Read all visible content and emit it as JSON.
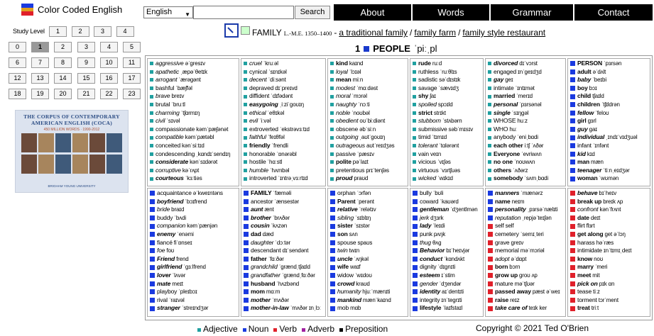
{
  "header": {
    "app_title": "Color Coded English",
    "language": "English",
    "search_placeholder": "",
    "search_button": "Search",
    "nav": [
      "About",
      "Words",
      "Grammar",
      "Contact"
    ]
  },
  "sidebar": {
    "level_label": "Study Level",
    "levels": [
      "1",
      "2",
      "3",
      "4",
      "0",
      "1",
      "2",
      "3",
      "4",
      "5",
      "6",
      "7",
      "8",
      "9",
      "10",
      "11",
      "12",
      "13",
      "14",
      "15",
      "16",
      "17",
      "18",
      "19",
      "20",
      "21",
      "22",
      "23"
    ]
  },
  "coca": {
    "title": "THE CORPUS OF CONTEMPORARY AMERICAN ENGLISH (COCA)",
    "sub": "450 MILLION WORDS · 1990-2012",
    "footer": "BRIGHAM YOUNG UNIVERSITY"
  },
  "entry": {
    "word": "FAMILY",
    "pos": "L.-M.E. 1350–1400",
    "dash": "-",
    "phrase1": "a traditional family",
    "slash1": "/",
    "phrase2": "family farm",
    "slash2": "/",
    "phrase3": "family style restaurant"
  },
  "section": {
    "number": "1",
    "title": "PEOPLE",
    "ipa": "ˈpiːˌpl"
  },
  "colors": {
    "adjective": "#20a0a0",
    "noun": "#1a3ae0",
    "verb": "#e0202a",
    "adverb": "#a020a0",
    "preposition": "#000000"
  },
  "columns": [
    [
      [
        [
          "a",
          "aggressive",
          "əˈgresɪv",
          1
        ],
        [
          "a",
          "apathetic",
          "ˌæpəˈθetɪk",
          1
        ],
        [
          "a",
          "arrogant",
          "ˈærəgənt",
          1
        ],
        [
          "a",
          "bashful",
          "ˈbæʃfəl",
          0
        ],
        [
          "a",
          "brave",
          "breɪv",
          1
        ],
        [
          "a",
          "brutal",
          "ˈbruːtl",
          0
        ],
        [
          "a",
          "charming",
          "ˈtʃɑrmɪŋ",
          1
        ],
        [
          "a",
          "civil",
          "ˈsɪvəl",
          1
        ],
        [
          "a",
          "compassionate",
          "kəmˈpæʃənət",
          0
        ],
        [
          "a",
          "compatible",
          "kəmˈpætəbl",
          1
        ],
        [
          "a",
          "conceited",
          "kənˈsiːtɪd",
          0
        ],
        [
          "a",
          "condescending",
          "ˌkɑndɪˈsendɪŋ",
          0
        ],
        [
          "a",
          "considerate",
          "kənˈsɪdərət",
          2
        ],
        [
          "a",
          "corruptive",
          "kəˈrʌpt",
          1
        ],
        [
          "a",
          "courteous",
          "ˈkɜːtiəs",
          2
        ]
      ],
      [
        [
          "n",
          "acquaintance",
          "əˈkweɪntəns",
          0
        ],
        [
          "n",
          "boyfriend",
          "ˈbɔɪfrend",
          2
        ],
        [
          "n",
          "bride",
          "braɪd",
          1
        ],
        [
          "n",
          "buddy",
          "ˈbʌdi",
          0
        ],
        [
          "n",
          "companion",
          "kəmˈpænjən",
          1
        ],
        [
          "n",
          "enemy",
          "ˈenəmi",
          2
        ],
        [
          "n",
          "fiancé",
          "fiˈɒnseɪ",
          0
        ],
        [
          "n",
          "foe",
          "foʊ",
          1
        ],
        [
          "n",
          "Friend",
          "frend",
          2
        ],
        [
          "n",
          "girlfriend",
          "ˈgɜːlfrend",
          2
        ],
        [
          "n",
          "lover",
          "ˈlʌvər",
          2
        ],
        [
          "n",
          "mate",
          "meɪt",
          2
        ],
        [
          "n",
          "playboy",
          "ˈpleɪbɔɪ",
          0
        ],
        [
          "n",
          "rival",
          "ˈraɪvəl",
          0
        ],
        [
          "n",
          "stranger",
          "ˈstreɪndʒər",
          2
        ]
      ]
    ],
    [
      [
        [
          "a",
          "cruel",
          "ˈkruːəl",
          1
        ],
        [
          "a",
          "cynical",
          "ˈsɪnɪkəl",
          0
        ],
        [
          "a",
          "decent",
          "ˈdiːsənt",
          1
        ],
        [
          "a",
          "depraved",
          "dɪˈpreɪvd",
          0
        ],
        [
          "a",
          "diffident",
          "ˈdɪfədənt",
          0
        ],
        [
          "a",
          "easygoing",
          "ˌiːziˈgoʊɪŋ",
          2
        ],
        [
          "a",
          "ethical",
          "ˈeθɪkəl",
          1
        ],
        [
          "a",
          "evil",
          "ˈiːvəl",
          1
        ],
        [
          "a",
          "extroverted",
          "ˈekstrəvɜːtɪd",
          0
        ],
        [
          "a",
          "faithful",
          "ˈfeɪθfəl",
          1
        ],
        [
          "a",
          "friendly",
          "ˈfrendli",
          3
        ],
        [
          "a",
          "honorable",
          "ˈɒnərəbl",
          0
        ],
        [
          "a",
          "hostile",
          "ˈhɑːstl",
          0
        ],
        [
          "a",
          "humble",
          "ˈhʌmbəl",
          1
        ],
        [
          "a",
          "introverted",
          "ˈɪntrəˌvɜːrtɪd",
          0
        ]
      ],
      [
        [
          "n",
          "FAMILY",
          "ˈfæməli",
          3
        ],
        [
          "n",
          "ancestor",
          "ˈænsestər",
          0
        ],
        [
          "n",
          "aunt",
          "ænt",
          2
        ],
        [
          "n",
          "brother",
          "ˈbrʌðər",
          2
        ],
        [
          "n",
          "cousin",
          "ˈkʌzən",
          2
        ],
        [
          "n",
          "dad",
          "dæd",
          3
        ],
        [
          "n",
          "daughter",
          "ˈdɔːtər",
          1
        ],
        [
          "n",
          "descendant",
          "dɪˈsendənt",
          0
        ],
        [
          "n",
          "father",
          "ˈfɑːðər",
          3
        ],
        [
          "n",
          "grandchild",
          "ˈgrændˌtʃaɪld",
          1
        ],
        [
          "n",
          "grandfather",
          "ˈgrændˌfɑːðər",
          1
        ],
        [
          "n",
          "husband",
          "ˈhʌzbənd",
          3
        ],
        [
          "n",
          "mom",
          "mɑːm",
          3
        ],
        [
          "n",
          "mother",
          "ˈmʌðər",
          2
        ],
        [
          "n",
          "mother-in-law",
          "ˈmʌðər ɪnˌlɔː",
          2
        ]
      ]
    ],
    [
      [
        [
          "a",
          "kind",
          "kaɪnd",
          3
        ],
        [
          "a",
          "loyal",
          "ˈlɔɪəl",
          1
        ],
        [
          "a",
          "mean",
          "miːn",
          3
        ],
        [
          "a",
          "modest",
          "ˈmɑːdəst",
          1
        ],
        [
          "a",
          "moral",
          "ˈmɔrəl",
          1
        ],
        [
          "a",
          "naughty",
          "ˈnɔːti",
          1
        ],
        [
          "a",
          "noble",
          "ˈnoʊbəl",
          1
        ],
        [
          "a",
          "obedient",
          "oʊˈbiːdiənt",
          1
        ],
        [
          "a",
          "obscene",
          "əbˈsiːn",
          0
        ],
        [
          "a",
          "outgoing",
          "ˌaʊtˈgoʊɪŋ",
          1
        ],
        [
          "a",
          "outrageous",
          "aʊtˈreɪdʒəs",
          1
        ],
        [
          "a",
          "passive",
          "ˈpæsɪv",
          0
        ],
        [
          "a",
          "polite",
          "pəˈlaɪt",
          3
        ],
        [
          "a",
          "pretentious",
          "prɪˈtenʃəs",
          0
        ],
        [
          "a",
          "proud",
          "praʊd",
          2
        ]
      ],
      [
        [
          "n",
          "orphan",
          "ˈɔrfən",
          0
        ],
        [
          "n",
          "Parent",
          "ˈperənt",
          3
        ],
        [
          "n",
          "relative",
          "ˈrelətɪv",
          2
        ],
        [
          "n",
          "sibling",
          "ˈsɪblɪŋ",
          1
        ],
        [
          "n",
          "sister",
          "ˈsɪstər",
          3
        ],
        [
          "n",
          "son",
          "sʌn",
          3
        ],
        [
          "n",
          "spouse",
          "spaʊs",
          0
        ],
        [
          "n",
          "twin",
          "twɪn",
          1
        ],
        [
          "n",
          "uncle",
          "ˈʌŋkəl",
          2
        ],
        [
          "n",
          "wife",
          "waɪf",
          3
        ],
        [
          "n",
          "widow",
          "ˈwɪdoʊ",
          0
        ],
        [
          "n",
          "crowd",
          "kraʊd",
          2
        ],
        [
          "n",
          "humanity",
          "hjuːˈmænɪti",
          1
        ],
        [
          "n",
          "mankind",
          "mænˈkaɪnd",
          2
        ],
        [
          "n",
          "mob",
          "mɑb",
          0
        ]
      ]
    ],
    [
      [
        [
          "a",
          "rude",
          "ruːd",
          3
        ],
        [
          "a",
          "ruthless",
          "ˈruːθlɪs",
          0
        ],
        [
          "a",
          "sadistic",
          "səˈdɪstɪk",
          0
        ],
        [
          "a",
          "savage",
          "ˈsævɪdʒ",
          0
        ],
        [
          "a",
          "shy",
          "ʃaɪ",
          3
        ],
        [
          "a",
          "spoiled",
          "spɔɪld",
          1
        ],
        [
          "a",
          "strict",
          "strɪkt",
          3
        ],
        [
          "a",
          "stubborn",
          "ˈstʌbərn",
          1
        ],
        [
          "a",
          "submissive",
          "səbˈmɪsɪv",
          0
        ],
        [
          "a",
          "timid",
          "ˈtɪmɪd",
          0
        ],
        [
          "a",
          "tolerant",
          "ˈtɑlərənt",
          1
        ],
        [
          "a",
          "vain",
          "veɪn",
          0
        ],
        [
          "a",
          "vicious",
          "ˈvɪʃəs",
          0
        ],
        [
          "a",
          "virtuous",
          "ˈvɜrtʃuəs",
          0
        ],
        [
          "a",
          "wicked",
          "ˈwɪkɪd",
          1
        ]
      ],
      [
        [
          "n",
          "bully",
          "ˈbʊli",
          0
        ],
        [
          "n",
          "coward",
          "ˈkaʊərd",
          0
        ],
        [
          "n",
          "gentleman",
          "ˈdʒentlmən",
          2
        ],
        [
          "n",
          "jerk",
          "dʒɜrk",
          1
        ],
        [
          "n",
          "lady",
          "ˈleɪdi",
          2
        ],
        [
          "n",
          "punk",
          "pʌŋk",
          0
        ],
        [
          "n",
          "thug",
          "θʌg",
          1
        ],
        [
          "n",
          "Behavior",
          "bɪˈheɪvjər",
          2
        ],
        [
          "n",
          "conduct",
          "ˈkɑndʌkt",
          2
        ],
        [
          "n",
          "dignity",
          "ˈdɪgnɪti",
          0
        ],
        [
          "n",
          "esteem",
          "ɪˈstim",
          2
        ],
        [
          "n",
          "gender",
          "ˈdʒendər",
          1
        ],
        [
          "n",
          "identity",
          "aɪˈdentɪti",
          2
        ],
        [
          "n",
          "integrity",
          "ɪnˈtegrɪti",
          0
        ],
        [
          "n",
          "lifestyle",
          "ˈlaɪfstaɪl",
          3
        ]
      ]
    ],
    [
      [
        [
          "a",
          "divorced",
          "dɪˈvɔrst",
          2
        ],
        [
          "a",
          "engaged",
          "ɪnˈgeɪdʒd",
          0
        ],
        [
          "a",
          "gay",
          "geɪ",
          2
        ],
        [
          "a",
          "intimate",
          "ˈɪntɪmət",
          0
        ],
        [
          "a",
          "married",
          "ˈmerɪd",
          3
        ],
        [
          "a",
          "personal",
          "ˈpɜrsənəl",
          2
        ],
        [
          "a",
          "single",
          "ˈsɪŋgəl",
          2
        ],
        [
          "a",
          "WHOSE",
          "huːz",
          0
        ],
        [
          "a",
          "WHO",
          "huː",
          0
        ],
        [
          "a",
          "anybody",
          "ˈeniˌbɑdi",
          0
        ],
        [
          "a",
          "each other",
          "iːtʃ ˈʌðər",
          3
        ],
        [
          "a",
          "Everyone",
          "ˈevriwʌn",
          3
        ],
        [
          "a",
          "no one",
          "ˈnoʊwʌn",
          3
        ],
        [
          "a",
          "others",
          "ˈʌðərz",
          3
        ],
        [
          "a",
          "somebody",
          "ˈsʌmˌbɑdi",
          3
        ]
      ],
      [
        [
          "n",
          "manners",
          "ˈmænərz",
          2
        ],
        [
          "n",
          "name",
          "neɪm",
          3
        ],
        [
          "n",
          "personality",
          "ˌpɜrsəˈnælɪti",
          2
        ],
        [
          "n",
          "reputation",
          "ˌrepjəˈteɪʃən",
          1
        ],
        [
          "v",
          "self",
          "self",
          0
        ],
        [
          "v",
          "cemetery",
          "ˈsemɪˌteri",
          0
        ],
        [
          "v",
          "grave",
          "greɪv",
          0
        ],
        [
          "v",
          "memorial",
          "məˈmɔriəl",
          0
        ],
        [
          "v",
          "adopt",
          "əˈdɑpt",
          1
        ],
        [
          "v",
          "born",
          "bɔrn",
          3
        ],
        [
          "v",
          "grow up",
          "groʊ ʌp",
          3
        ],
        [
          "v",
          "mature",
          "məˈtʃʊər",
          0
        ],
        [
          "v",
          "passed away",
          "pæst əˈweɪ",
          3
        ],
        [
          "v",
          "raise",
          "reɪz",
          3
        ],
        [
          "v",
          "take care of",
          "teɪk ker",
          2
        ]
      ]
    ],
    [
      [
        [
          "n",
          "PERSON",
          "ˈpɜrsən",
          3
        ],
        [
          "n",
          "adult",
          "əˈdʌlt",
          3
        ],
        [
          "n",
          "baby",
          "ˈbeɪbi",
          2
        ],
        [
          "n",
          "boy",
          "bɔɪ",
          3
        ],
        [
          "n",
          "child",
          "tʃaɪld",
          3
        ],
        [
          "n",
          "children",
          "ˈtʃɪldrən",
          3
        ],
        [
          "n",
          "fellow",
          "ˈfeloʊ",
          2
        ],
        [
          "n",
          "girl",
          "gɜrl",
          3
        ],
        [
          "n",
          "guy",
          "gaɪ",
          2
        ],
        [
          "n",
          "individual",
          "ˌɪndɪˈvɪdʒuəl",
          2
        ],
        [
          "n",
          "infant",
          "ˈɪnfənt",
          0
        ],
        [
          "n",
          "kid",
          "kɪd",
          2
        ],
        [
          "n",
          "man",
          "mæn",
          3
        ],
        [
          "n",
          "teenager",
          "ˈtiːnˌeɪdʒər",
          2
        ],
        [
          "n",
          "woman",
          "ˈwʊmən",
          3
        ]
      ],
      [
        [
          "v",
          "behave",
          "bɪˈheɪv",
          2
        ],
        [
          "v",
          "break up",
          "breɪk ʌp",
          3
        ],
        [
          "v",
          "confront",
          "kənˈfrʌnt",
          1
        ],
        [
          "v",
          "date",
          "deɪt",
          3
        ],
        [
          "v",
          "flirt",
          "flɜrt",
          0
        ],
        [
          "v",
          "get along",
          "get əˈlɔŋ",
          3
        ],
        [
          "v",
          "harass",
          "həˈræs",
          0
        ],
        [
          "v",
          "intimidate",
          "ɪnˈtɪmɪˌdeɪt",
          0
        ],
        [
          "v",
          "know",
          "noʊ",
          3
        ],
        [
          "v",
          "marry",
          "ˈmeri",
          3
        ],
        [
          "v",
          "meet",
          "mit",
          3
        ],
        [
          "v",
          "pick on",
          "pɪk ɑn",
          2
        ],
        [
          "v",
          "tease",
          "tiːz",
          0
        ],
        [
          "v",
          "torment",
          "tɔrˈment",
          0
        ],
        [
          "v",
          "treat",
          "triːt",
          3
        ]
      ]
    ]
  ],
  "legend": [
    [
      "adjective",
      "Adjective"
    ],
    [
      "noun",
      "Noun"
    ],
    [
      "verb",
      "Verb"
    ],
    [
      "adverb",
      "Adverb"
    ],
    [
      "preposition",
      "Preposition"
    ]
  ],
  "copyright": "Copyright © 2021 Ted O'Brien"
}
